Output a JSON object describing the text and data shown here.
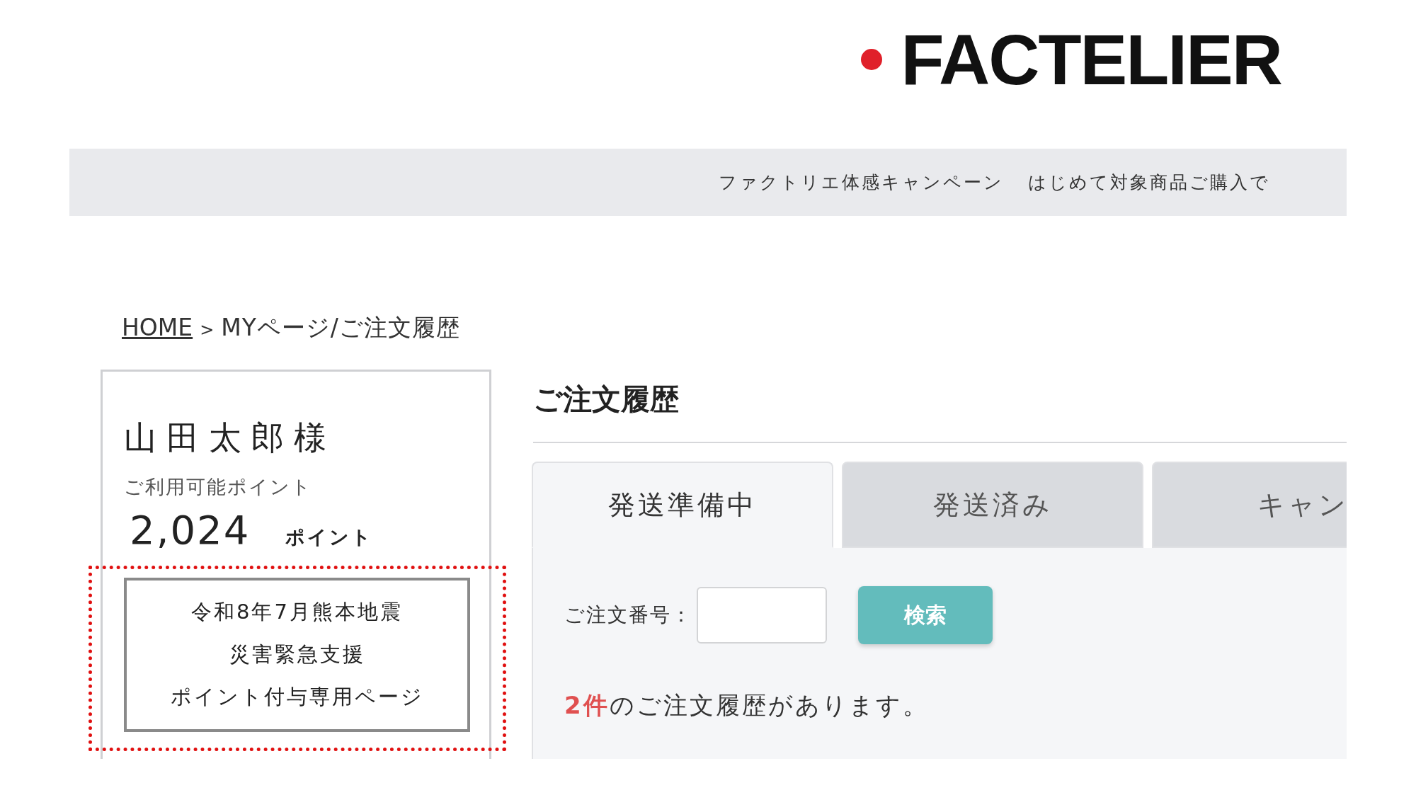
{
  "logo": {
    "text": "FACTELIER"
  },
  "banner": {
    "texts": [
      "ファクトリエ体感キャンペーン",
      "はじめて対象商品ご購入で"
    ]
  },
  "breadcrumb": {
    "home": "HOME",
    "separator": ">",
    "current": "MYページ/ご注文履歴"
  },
  "account": {
    "name": "山田太郎様",
    "points_label": "ご利用可能ポイント",
    "points": "2,024",
    "points_unit": "ポイント",
    "notice_lines": [
      "令和8年7月熊本地震",
      "災害緊急支援",
      "ポイント付与専用ページ"
    ]
  },
  "orders": {
    "title": "ご注文履歴",
    "tabs": [
      {
        "label": "発送準備中",
        "selected": true
      },
      {
        "label": "発送済み",
        "selected": false
      },
      {
        "label": "キャン",
        "selected": false
      }
    ],
    "search_label": "ご注文番号：",
    "search_button": "検索",
    "count": "2件",
    "count_text": "のご注文履歴があります。"
  }
}
